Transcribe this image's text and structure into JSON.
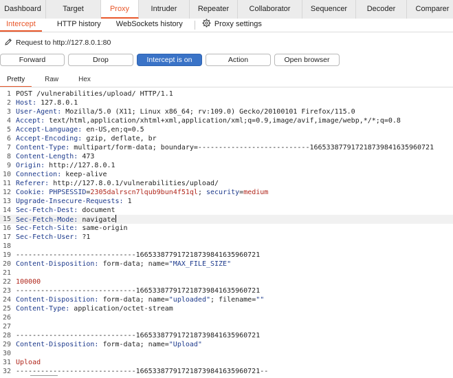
{
  "top_tabs": [
    {
      "label": "Dashboard",
      "w": 66
    },
    {
      "label": "Target",
      "w": 79
    },
    {
      "label": "Proxy",
      "w": 55,
      "active": true
    },
    {
      "label": "Intruder",
      "w": 73
    },
    {
      "label": "Repeater",
      "w": 69
    },
    {
      "label": "Collaborator",
      "w": 93
    },
    {
      "label": "Sequencer",
      "w": 77
    },
    {
      "label": "Decoder",
      "w": 73
    },
    {
      "label": "Comparer",
      "w": 74
    }
  ],
  "sub_tabs": {
    "intercept": "Intercept",
    "http_history": "HTTP history",
    "websockets_history": "WebSockets history",
    "proxy_settings": "Proxy settings"
  },
  "request_info": "Request to http://127.8.0.1:80",
  "buttons": {
    "forward": "Forward",
    "drop": "Drop",
    "intercept": "Intercept is on",
    "action": "Action",
    "open_browser": "Open browser"
  },
  "editor_tabs": {
    "pretty": "Pretty",
    "raw": "Raw",
    "hex": "Hex"
  },
  "lines": [
    {
      "n": "1",
      "t": "POST /vulnerabilities/upload/ HTTP/1.1"
    },
    {
      "n": "2",
      "k": "Host:",
      "v": " 127.8.0.1"
    },
    {
      "n": "3",
      "k": "User-Agent:",
      "v": " Mozilla/5.0 (X11; Linux x86_64; rv:109.0) Gecko/20100101 Firefox/115.0"
    },
    {
      "n": "4",
      "k": "Accept:",
      "v": " text/html,application/xhtml+xml,application/xml;q=0.9,image/avif,image/webp,*/*;q=0.8"
    },
    {
      "n": "5",
      "k": "Accept-Language:",
      "v": " en-US,en;q=0.5"
    },
    {
      "n": "6",
      "k": "Accept-Encoding:",
      "v": " gzip, deflate, br"
    },
    {
      "n": "7",
      "k": "Content-Type:",
      "v": " multipart/form-data; boundary=---------------------------166533877917218739841635960721"
    },
    {
      "n": "8",
      "k": "Content-Length:",
      "v": " 473"
    },
    {
      "n": "9",
      "k": "Origin:",
      "v": " http://127.8.0.1"
    },
    {
      "n": "10",
      "k": "Connection:",
      "v": " keep-alive"
    },
    {
      "n": "11",
      "k": "Referer:",
      "v": " http://127.8.0.1/vulnerabilities/upload/"
    },
    {
      "n": "12",
      "k": "Cookie:",
      "v": " ",
      "cookie": {
        "n1": "PHPSESSID",
        "e1": "=",
        "v1": "2305dalrscn7lqub9bun4f51ql",
        "sep": "; ",
        "n2": "security",
        "e2": "=",
        "v2": "medium"
      }
    },
    {
      "n": "13",
      "k": "Upgrade-Insecure-Requests:",
      "v": " 1"
    },
    {
      "n": "14",
      "k": "Sec-Fetch-Dest:",
      "v": " document"
    },
    {
      "n": "15",
      "k": "Sec-Fetch-Mode:",
      "v": " navigate",
      "cursor": true
    },
    {
      "n": "16",
      "k": "Sec-Fetch-Site:",
      "v": " same-origin"
    },
    {
      "n": "17",
      "k": "Sec-Fetch-User:",
      "v": " ?1"
    },
    {
      "n": "18",
      "t": ""
    },
    {
      "n": "19",
      "t": "-----------------------------166533877917218739841635960721"
    },
    {
      "n": "20",
      "k": "Content-Disposition:",
      "v": " form-data; name=",
      "q": "\"MAX_FILE_SIZE\""
    },
    {
      "n": "21",
      "t": ""
    },
    {
      "n": "22",
      "s": "100000"
    },
    {
      "n": "23",
      "t": "-----------------------------166533877917218739841635960721"
    },
    {
      "n": "24",
      "k": "Content-Disposition:",
      "v": " form-data; name=",
      "q": "\"uploaded\"",
      "v2": "; filename=",
      "q2": "\"\""
    },
    {
      "n": "25",
      "k": "Content-Type:",
      "v": " application/octet-stream"
    },
    {
      "n": "26",
      "t": ""
    },
    {
      "n": "27",
      "t": ""
    },
    {
      "n": "28",
      "t": "-----------------------------166533877917218739841635960721"
    },
    {
      "n": "29",
      "k": "Content-Disposition:",
      "v": " form-data; name=",
      "q": "\"Upload\""
    },
    {
      "n": "30",
      "t": ""
    },
    {
      "n": "31",
      "s": "Upload"
    },
    {
      "n": "32",
      "t": "-----------------------------166533877917218739841635960721--"
    }
  ]
}
